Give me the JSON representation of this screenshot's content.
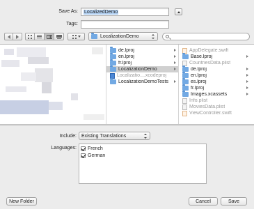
{
  "save": {
    "save_as_label": "Save As:",
    "save_as_value": "LocalizedDemo",
    "tags_label": "Tags:",
    "tags_value": ""
  },
  "toolbar": {
    "location": "LocalizationDemo"
  },
  "browser": {
    "column2": [
      {
        "name": "de.lproj",
        "type": "folder",
        "chevron": true
      },
      {
        "name": "en.lproj",
        "type": "folder",
        "chevron": true
      },
      {
        "name": "fr.lproj",
        "type": "folder",
        "chevron": true
      },
      {
        "name": "LocalizationDemo",
        "type": "folder",
        "chevron": true,
        "selected": true
      },
      {
        "name": "Localizatio....xcodeproj",
        "type": "proj",
        "chevron": false,
        "disabled": true
      },
      {
        "name": "LocalizationDemoTests",
        "type": "folder",
        "chevron": true
      }
    ],
    "column3": [
      {
        "name": "AppDelegate.swift",
        "type": "swift",
        "chevron": false,
        "disabled": true
      },
      {
        "name": "Base.lproj",
        "type": "folder",
        "chevron": true
      },
      {
        "name": "CountriesData.plist",
        "type": "plist",
        "chevron": false,
        "disabled": true
      },
      {
        "name": "de.lproj",
        "type": "folder",
        "chevron": true
      },
      {
        "name": "en.lproj",
        "type": "folder",
        "chevron": true
      },
      {
        "name": "es.lproj",
        "type": "folder",
        "chevron": true
      },
      {
        "name": "fr.lproj",
        "type": "folder",
        "chevron": true
      },
      {
        "name": "Images.xcassets",
        "type": "folder",
        "chevron": true
      },
      {
        "name": "Info.plist",
        "type": "plist",
        "chevron": false,
        "disabled": true
      },
      {
        "name": "MoviesData.plist",
        "type": "plist",
        "chevron": false,
        "disabled": true
      },
      {
        "name": "ViewController.swift",
        "type": "swift",
        "chevron": false,
        "disabled": true
      }
    ]
  },
  "options": {
    "include_label": "Include:",
    "include_value": "Existing Translations",
    "languages_label": "Languages:",
    "languages": [
      {
        "name": "French",
        "checked": true
      },
      {
        "name": "German",
        "checked": true
      }
    ]
  },
  "buttons": {
    "new_folder": "New Folder",
    "cancel": "Cancel",
    "save": "Save"
  },
  "colors": {
    "selection": "#d0d0d0",
    "folder": "#72a9e3",
    "text_selection": "#b4d3f5"
  }
}
